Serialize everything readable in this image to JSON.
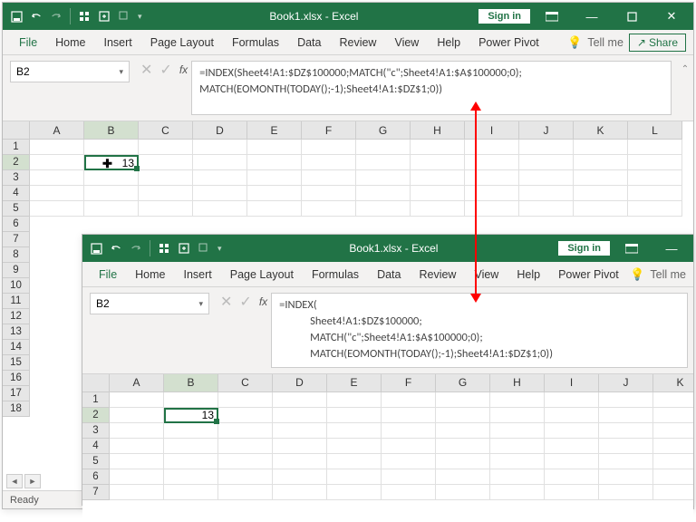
{
  "win1": {
    "title": "Book1.xlsx - Excel",
    "signin": "Sign in",
    "menu": [
      "File",
      "Home",
      "Insert",
      "Page Layout",
      "Formulas",
      "Data",
      "Review",
      "View",
      "Help",
      "Power Pivot"
    ],
    "tellme": "Tell me",
    "share": "Share",
    "namebox": "B2",
    "formula": "=INDEX(Sheet4!A1:$DZ$100000;MATCH(\"c\";Sheet4!A1:$A$100000;0);\nMATCH(EOMONTH(TODAY();-1);Sheet4!A1:$DZ$1;0))",
    "cols": [
      "A",
      "B",
      "C",
      "D",
      "E",
      "F",
      "G",
      "H",
      "I",
      "J",
      "K",
      "L"
    ],
    "rows": [
      "1",
      "2",
      "3",
      "4",
      "5",
      "6",
      "7",
      "8",
      "9",
      "10",
      "11",
      "12",
      "13",
      "14",
      "15",
      "16",
      "17",
      "18"
    ],
    "b2": "13",
    "status": "Ready"
  },
  "win2": {
    "title": "Book1.xlsx - Excel",
    "signin": "Sign in",
    "menu": [
      "File",
      "Home",
      "Insert",
      "Page Layout",
      "Formulas",
      "Data",
      "Review",
      "View",
      "Help",
      "Power Pivot"
    ],
    "tellme": "Tell me",
    "namebox": "B2",
    "formula": "=INDEX(\n            Sheet4!A1:$DZ$100000;\n            MATCH(\"c\";Sheet4!A1:$A$100000;0);\n            MATCH(EOMONTH(TODAY();-1);Sheet4!A1:$DZ$1;0))",
    "cols": [
      "A",
      "B",
      "C",
      "D",
      "E",
      "F",
      "G",
      "H",
      "I",
      "J",
      "K"
    ],
    "rows": [
      "1",
      "2",
      "3",
      "4",
      "5",
      "6",
      "7"
    ],
    "b2": "13"
  }
}
